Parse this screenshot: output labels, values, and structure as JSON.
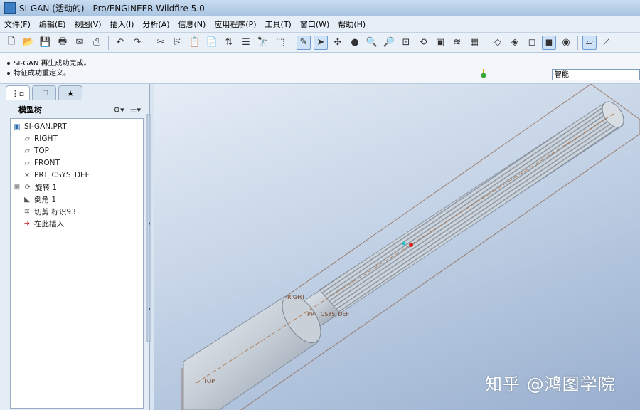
{
  "window": {
    "title": "SI-GAN (活动的) - Pro/ENGINEER Wildfire 5.0"
  },
  "menu": [
    "文件(F)",
    "编辑(E)",
    "视图(V)",
    "插入(I)",
    "分析(A)",
    "信息(N)",
    "应用程序(P)",
    "工具(T)",
    "窗口(W)",
    "帮助(H)"
  ],
  "messages": [
    "SI-GAN 再生成功完成。",
    "特征成功重定义。"
  ],
  "filter": {
    "value": "智能"
  },
  "model_tree": {
    "header": "模型树",
    "items": [
      {
        "label": "SI-GAN.PRT",
        "icon": "part-icon"
      },
      {
        "label": "RIGHT",
        "icon": "datum-plane-icon"
      },
      {
        "label": "TOP",
        "icon": "datum-plane-icon"
      },
      {
        "label": "FRONT",
        "icon": "datum-plane-icon"
      },
      {
        "label": "PRT_CSYS_DEF",
        "icon": "csys-icon"
      },
      {
        "label": "旋转 1",
        "icon": "revolve-icon"
      },
      {
        "label": "倒角 1",
        "icon": "chamfer-icon"
      },
      {
        "label": "切剪 标识93",
        "icon": "cut-icon"
      },
      {
        "label": "在此插入",
        "icon": "insert-here-icon"
      }
    ]
  },
  "viewport": {
    "labels": {
      "right": "RIGHT",
      "csys": "PRT_CSYS_DEF",
      "top": "TOP"
    }
  },
  "watermark": {
    "text": "知乎 @鸿图学院"
  },
  "colors": {
    "viewport_top": "#e6edf6",
    "viewport_bottom": "#98afcf",
    "model": "#cfd6de",
    "datum": "#8a5a3c"
  }
}
